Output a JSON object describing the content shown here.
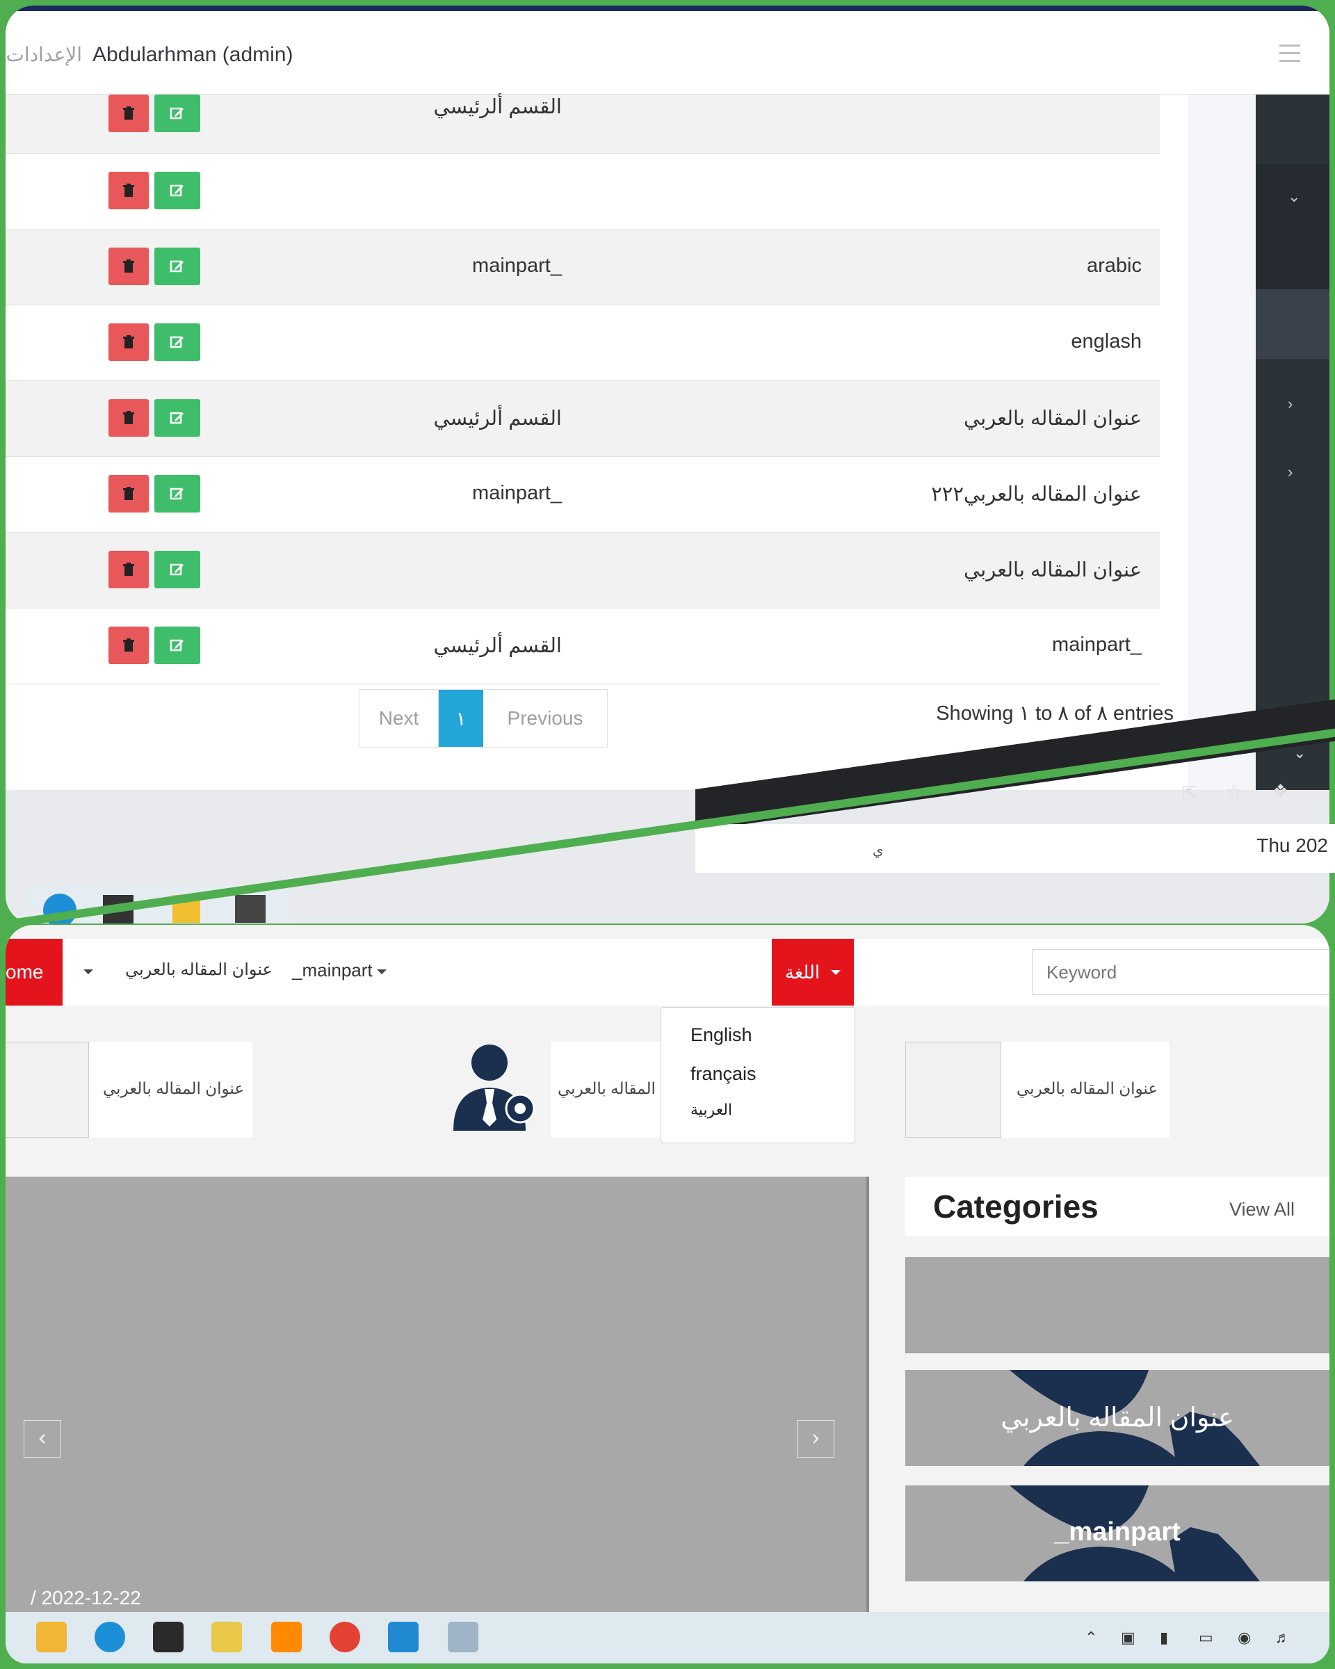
{
  "admin": {
    "navbar": {
      "settings_label": "الإعدادات",
      "user_label": "Abdularhman (admin)"
    },
    "table": {
      "rows": [
        {
          "part": "القسم ألرئيسي",
          "title": ""
        },
        {
          "part": "",
          "title": ""
        },
        {
          "part": "mainpart_",
          "title": "arabic"
        },
        {
          "part": "",
          "title": "englash"
        },
        {
          "part": "القسم ألرئيسي",
          "title": "عنوان المقاله بالعربي"
        },
        {
          "part": "mainpart_",
          "title": "عنوان المقاله بالعربي٢٢٢"
        },
        {
          "part": "",
          "title": "عنوان المقاله بالعربي"
        },
        {
          "part": "القسم ألرئيسي",
          "title": "mainpart_"
        }
      ]
    },
    "pagination": {
      "next_label": "Next",
      "page_number": "١",
      "previous_label": "Previous",
      "info": "Showing ١ to ٨ of ٨ entries"
    },
    "browser_strip": {
      "date_prefix": "Thu 202",
      "small_text": "ي"
    }
  },
  "site": {
    "nav": {
      "home_label": "ome",
      "item_article": "عنوان المقاله بالعربي",
      "item_mainpart": "_mainpart",
      "language_button": "اللغة",
      "search_placeholder": "Keyword"
    },
    "language_menu": {
      "options": [
        "English",
        "français",
        "العربية"
      ]
    },
    "cards": [
      {
        "text": "عنوان المقاله بالعربي"
      },
      {
        "text": "عنوان المقاله بالعربي"
      },
      {
        "text": "عنوان المقاله بالعربي"
      }
    ],
    "slider": {
      "date": "/  2022-12-22"
    },
    "categories": {
      "title": "Categories",
      "view_all": "View All",
      "items": [
        {
          "label": ""
        },
        {
          "label": "عنوان المقاله بالعربي"
        },
        {
          "label": "_mainpart"
        }
      ]
    }
  },
  "colors": {
    "delete": "#e8585a",
    "edit": "#3ebd6a",
    "active_page": "#22a6d8",
    "brand_red": "#e3141c",
    "frame_green": "#4fae4f"
  }
}
